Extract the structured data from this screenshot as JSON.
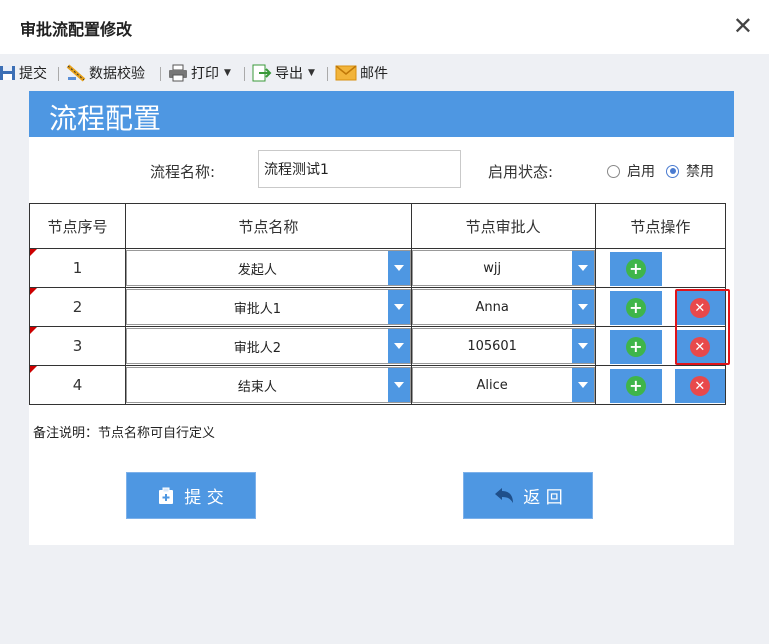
{
  "window": {
    "title": "审批流配置修改",
    "close_glyph": "✕"
  },
  "toolbar": [
    {
      "label": "提交",
      "icon": "save-icon"
    },
    {
      "label": "数据校验",
      "icon": "ruler-pencil-icon"
    },
    {
      "label": "打印",
      "icon": "printer-icon",
      "dropdown": true
    },
    {
      "label": "导出",
      "icon": "export-icon",
      "dropdown": true
    },
    {
      "label": "邮件",
      "icon": "mail-icon"
    }
  ],
  "panel": {
    "heading": "流程配置",
    "process_name_label": "流程名称:",
    "process_name_value": "流程测试1",
    "status_label": "启用状态:",
    "status_options": [
      {
        "label": "启用",
        "checked": false
      },
      {
        "label": "禁用",
        "checked": true
      }
    ]
  },
  "table": {
    "headers": [
      "节点序号",
      "节点名称",
      "节点审批人",
      "节点操作"
    ],
    "rows": [
      {
        "seq": "1",
        "name": "发起人",
        "approver": "wjj",
        "can_delete": false
      },
      {
        "seq": "2",
        "name": "审批人1",
        "approver": "Anna",
        "can_delete": true
      },
      {
        "seq": "3",
        "name": "审批人2",
        "approver": "105601",
        "can_delete": true
      },
      {
        "seq": "4",
        "name": "结束人",
        "approver": "Alice",
        "can_delete": true
      }
    ]
  },
  "note": "备注说明：节点名称可自行定义",
  "buttons": {
    "submit": "提 交",
    "back": "返 回"
  },
  "colors": {
    "accent": "#4e97e2",
    "add": "#3fb54a",
    "delete": "#e8494b",
    "highlight": "#e0141a"
  }
}
